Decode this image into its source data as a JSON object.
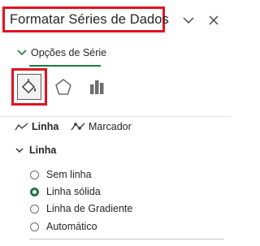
{
  "panel": {
    "title": "Formatar Séries de Dados",
    "collapse_icon": "chevron-down-icon",
    "close_icon": "close-icon"
  },
  "series_options": {
    "label": "Opções de Série"
  },
  "tools": [
    {
      "name": "fill-line-icon",
      "selected": true
    },
    {
      "name": "effects-pentagon-icon",
      "selected": false
    },
    {
      "name": "series-options-bars-icon",
      "selected": false
    }
  ],
  "tabs": [
    {
      "label": "Linha",
      "icon": "line-icon",
      "active": true
    },
    {
      "label": "Marcador",
      "icon": "marker-icon",
      "active": false
    }
  ],
  "section": {
    "label": "Linha",
    "expanded": true
  },
  "line_options": [
    {
      "label": "Sem linha",
      "checked": false
    },
    {
      "label": "Linha sólida",
      "checked": true
    },
    {
      "label": "Linha de Gradiente",
      "checked": false
    },
    {
      "label": "Automático",
      "checked": false
    }
  ],
  "colors": {
    "accent": "#1b7a43",
    "highlight_border": "#e0141e"
  }
}
